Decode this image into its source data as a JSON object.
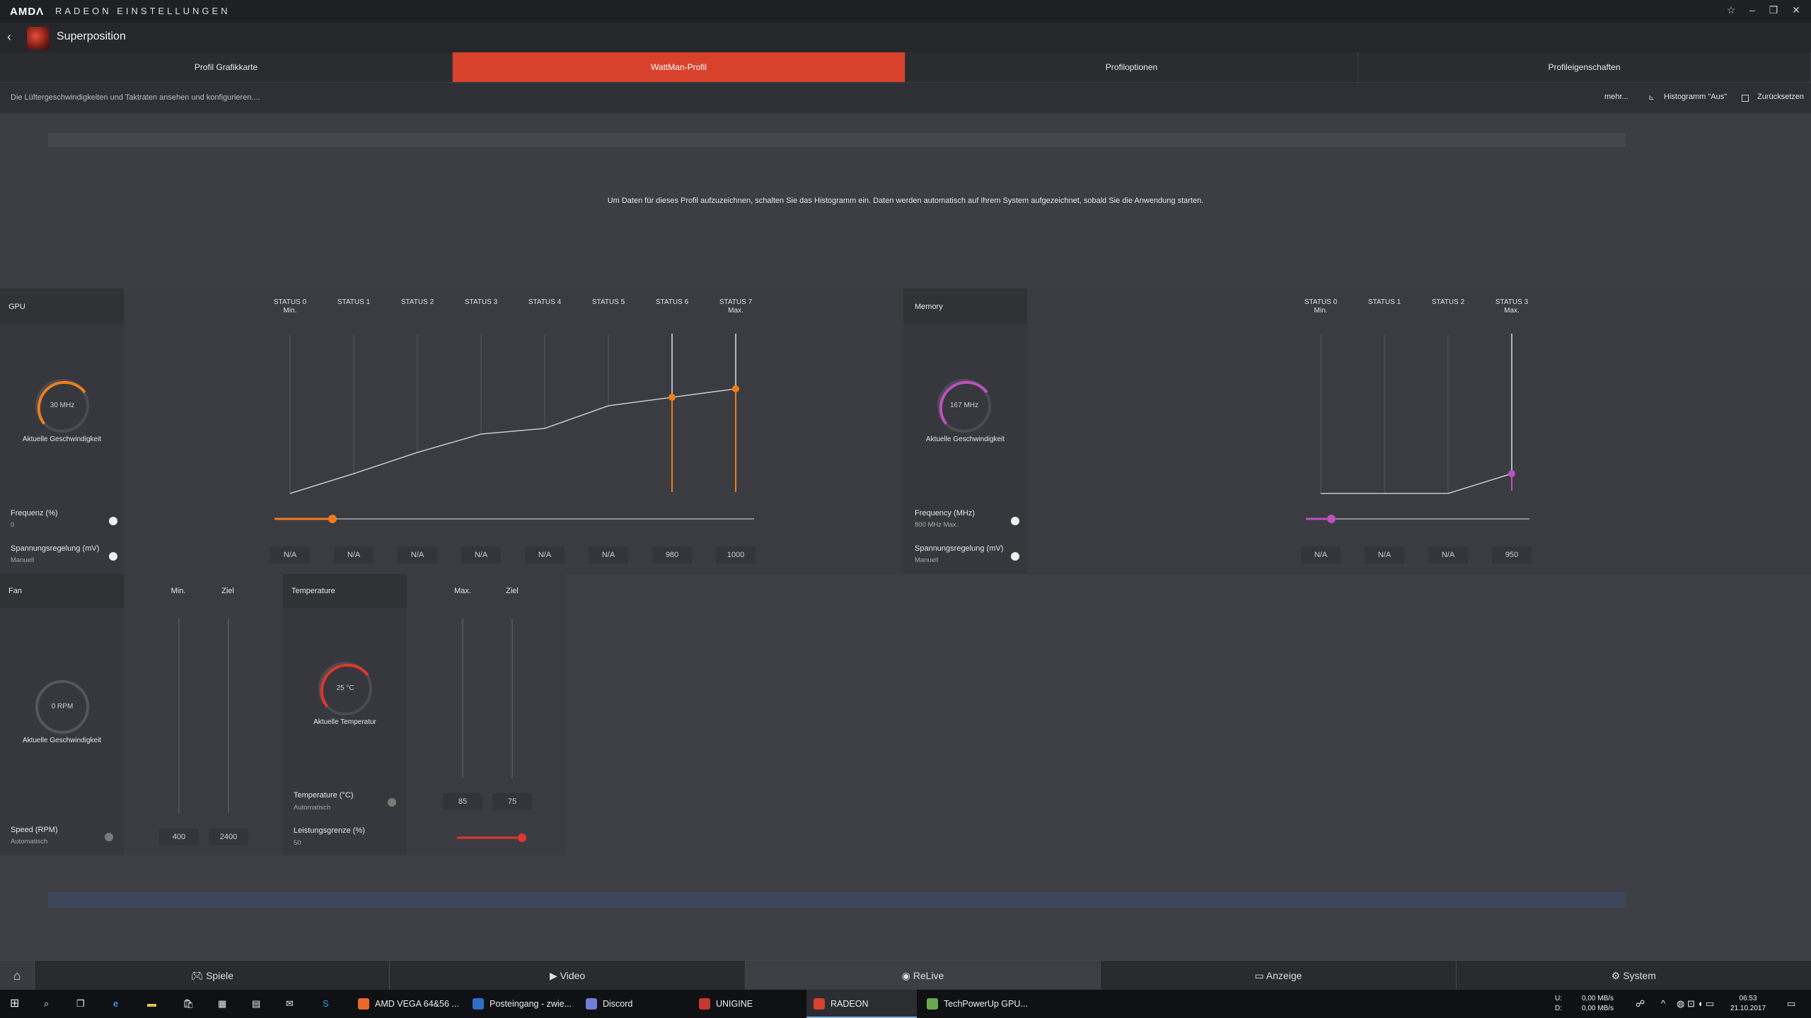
{
  "titlebar": {
    "brand": "AMDΛ",
    "app": "RADEON EINSTELLUNGEN",
    "icons": [
      "star-icon",
      "minimize-icon",
      "restore-icon",
      "close-icon"
    ]
  },
  "profile": {
    "title": "Superposition"
  },
  "tabs": [
    {
      "label": "Profil Grafikkarte"
    },
    {
      "label": "WattMan-Profil",
      "active": true
    },
    {
      "label": "Profiloptionen"
    },
    {
      "label": "Profileigenschaften"
    }
  ],
  "subbar": {
    "description": "Die Lüftergeschwindigkeiten und Taktraten ansehen und konfigurieren....",
    "more": "mehr...",
    "histogram": "Histogramm \"Aus\"",
    "reset": "Zurücksetzen"
  },
  "histogram_message": "Um Daten für dieses Profil aufzuzeichnen, schalten Sie das Histogramm ein. Daten werden automatisch auf Ihrem System aufgezeichnet, sobald Sie die Anwendung starten.",
  "gpu": {
    "label": "GPU",
    "gauge_value": "30 MHz",
    "gauge_label": "Aktuelle Geschwindigkeit",
    "status_labels": [
      {
        "t": "STATUS 0",
        "s": "Min."
      },
      {
        "t": "STATUS 1",
        "s": ""
      },
      {
        "t": "STATUS 2",
        "s": ""
      },
      {
        "t": "STATUS 3",
        "s": ""
      },
      {
        "t": "STATUS 4",
        "s": ""
      },
      {
        "t": "STATUS 5",
        "s": ""
      },
      {
        "t": "STATUS 6",
        "s": ""
      },
      {
        "t": "STATUS 7",
        "s": "Max."
      }
    ],
    "frequency_label": "Frequenz (%)",
    "frequency_value": "0",
    "voltage_label": "Spannungsregelung (mV)",
    "voltage_mode": "Manuell",
    "voltage_values": [
      "N/A",
      "N/A",
      "N/A",
      "N/A",
      "N/A",
      "N/A",
      "980",
      "1000"
    ],
    "accent": "#f07d1a"
  },
  "memory": {
    "label": "Memory",
    "gauge_value": "167 MHz",
    "gauge_label": "Aktuelle Geschwindigkeit",
    "status_labels": [
      {
        "t": "STATUS 0",
        "s": "Min."
      },
      {
        "t": "STATUS 1",
        "s": ""
      },
      {
        "t": "STATUS 2",
        "s": ""
      },
      {
        "t": "STATUS 3",
        "s": "Max."
      }
    ],
    "frequency_label": "Frequency (MHz)",
    "frequency_value": "800 MHz Max.",
    "voltage_label": "Spannungsregelung (mV)",
    "voltage_mode": "Manuell",
    "voltage_values": [
      "N/A",
      "N/A",
      "N/A",
      "950"
    ],
    "accent": "#c04fc0"
  },
  "fan": {
    "label": "Fan",
    "col_min": "Min.",
    "col_target": "Ziel",
    "gauge_value": "0 RPM",
    "gauge_label": "Aktuelle Geschwindigkeit",
    "speed_label": "Speed (RPM)",
    "speed_mode": "Automatisch",
    "min_value": "400",
    "target_value": "2400"
  },
  "temperature": {
    "label": "Temperature",
    "col_max": "Max.",
    "col_target": "Ziel",
    "gauge_value": "25 °C",
    "gauge_label": "Aktuelle Temperatur",
    "temp_label": "Temperature (°C)",
    "temp_mode": "Automatisch",
    "max_value": "85",
    "target_value": "75",
    "power_label": "Leistungsgrenze (%)",
    "power_value": "50",
    "accent": "#e2362b"
  },
  "bottomnav": [
    {
      "label": "Spiele",
      "icon": "gamepad-icon"
    },
    {
      "label": "Video",
      "icon": "play-icon"
    },
    {
      "label": "ReLive",
      "icon": "relive-icon",
      "active": true
    },
    {
      "label": "Anzeige",
      "icon": "monitor-icon"
    },
    {
      "label": "System",
      "icon": "system-icon"
    }
  ],
  "taskbar": {
    "tasks": [
      {
        "label": "AMD VEGA 64&56 ...",
        "color": "#e8692a"
      },
      {
        "label": "Posteingang - zwie...",
        "color": "#2e6fc9"
      },
      {
        "label": "Discord",
        "color": "#6e7fd8"
      },
      {
        "label": "UNIGINE Superposi...",
        "color": "#c7372e"
      },
      {
        "label": "RADEON EINSTELL...",
        "color": "#d8412b",
        "active": true
      },
      {
        "label": "TechPowerUp GPU...",
        "color": "#6aa84f"
      }
    ],
    "net_up": "0,00 MB/s",
    "net_down": "0,00 MB/s",
    "net_u": "U:",
    "net_d": "D:",
    "time": "06:53",
    "date": "21.10.2017"
  }
}
